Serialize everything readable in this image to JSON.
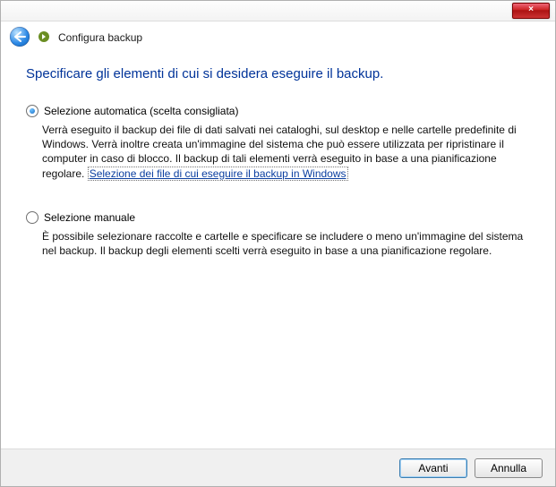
{
  "titlebar": {
    "close_glyph": "×"
  },
  "header": {
    "wizard_title": "Configura backup"
  },
  "heading": "Specificare gli elementi di cui si desidera eseguire il backup.",
  "options": {
    "auto": {
      "label": "Selezione automatica (scelta consigliata)",
      "desc_pre": "Verrà eseguito il backup dei file di dati salvati nei cataloghi, sul desktop e nelle cartelle predefinite di Windows. Verrà inoltre creata un'immagine del sistema che può essere utilizzata per ripristinare il computer in caso di blocco. Il backup di tali elementi verrà eseguito in base a una pianificazione regolare. ",
      "link": "Selezione dei file di cui eseguire il backup in Windows",
      "selected": true
    },
    "manual": {
      "label": "Selezione manuale",
      "desc": "È possibile selezionare raccolte e cartelle e specificare se includere o meno un'immagine del sistema nel backup. Il backup degli elementi scelti verrà eseguito in base a una pianificazione regolare.",
      "selected": false
    }
  },
  "footer": {
    "next": "Avanti",
    "cancel": "Annulla"
  }
}
